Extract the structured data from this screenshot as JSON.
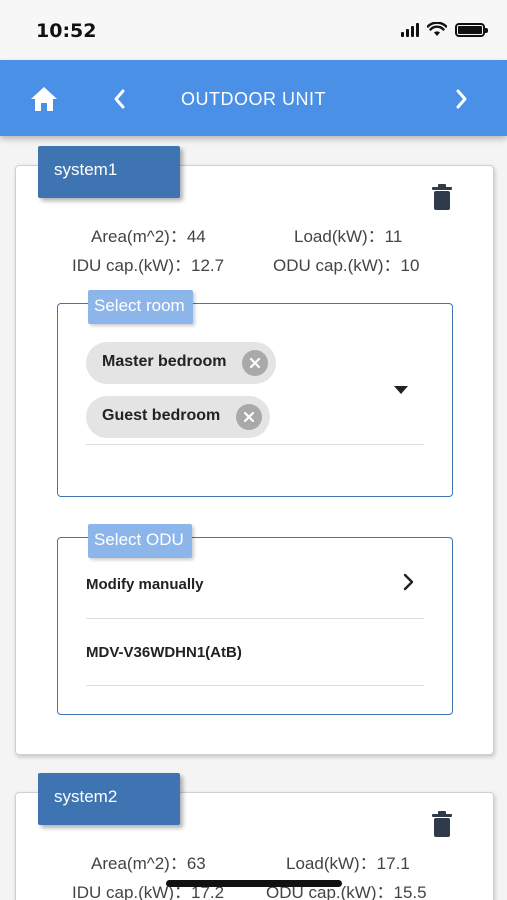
{
  "status": {
    "time": "10:52"
  },
  "nav": {
    "title": "OUTDOOR UNIT"
  },
  "systems": [
    {
      "name": "system1",
      "area_label": "Area(m^2)：44",
      "load_label": "Load(kW)：11",
      "idu_label": "IDU cap.(kW)：12.7",
      "odu_label": "ODU cap.(kW)：10",
      "select_room_label": "Select room",
      "rooms": [
        "Master bedroom",
        "Guest bedroom"
      ],
      "select_odu_label": "Select ODU",
      "odu_options": [
        "Modify manually",
        "MDV-V36WDHN1(AtB)"
      ]
    },
    {
      "name": "system2",
      "area_label": "Area(m^2)：63",
      "load_label": "Load(kW)：17.1",
      "idu_label": "IDU cap.(kW)：17.2",
      "odu_label": "ODU cap.(kW)：15.5"
    }
  ],
  "colors": {
    "nav_bar": "#4a90e6",
    "system_tag": "#3e74b2",
    "select_label": "#8cb6ea",
    "chip": "#e4e4e4"
  },
  "icons": {
    "home": "home-icon",
    "prev": "chevron-left-icon",
    "next": "chevron-right-icon",
    "delete": "trash-icon",
    "chip_remove": "close-circle-icon",
    "dropdown": "caret-down-icon"
  }
}
